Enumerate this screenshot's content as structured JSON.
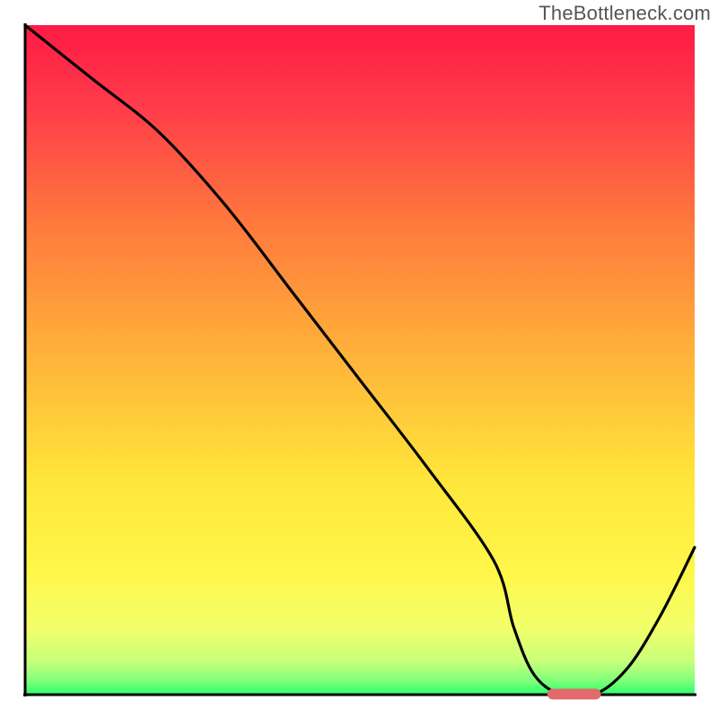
{
  "watermark": "TheBottleneck.com",
  "colors": {
    "curve": "#000000",
    "marker": "#e26a6a",
    "gradient_top": "#ff1a45",
    "gradient_bottom": "#2bff6a"
  },
  "chart_data": {
    "type": "line",
    "title": "",
    "xlabel": "",
    "ylabel": "",
    "xlim": [
      0,
      100
    ],
    "ylim": [
      0,
      100
    ],
    "x": [
      0,
      10,
      20,
      30,
      40,
      50,
      60,
      70,
      73,
      76,
      80,
      85,
      90,
      95,
      100
    ],
    "y": [
      100,
      92,
      84,
      73,
      60,
      47,
      34,
      20,
      10,
      3,
      0,
      0,
      4,
      12,
      22
    ],
    "optimal_range_x": [
      78,
      86
    ],
    "marker": {
      "x_start": 78,
      "x_end": 86,
      "y": 0,
      "height_pct": 1.6
    }
  }
}
